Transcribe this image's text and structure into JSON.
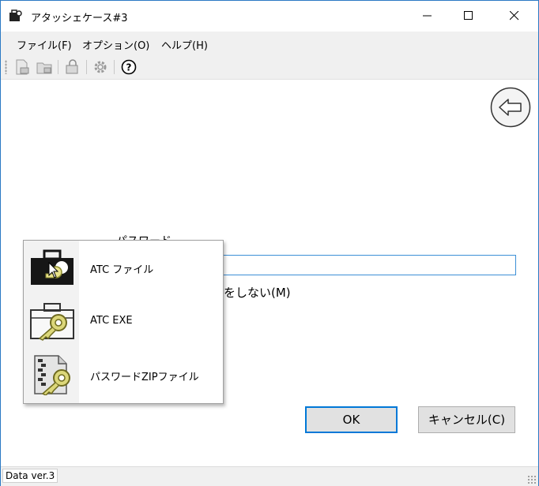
{
  "window": {
    "title": "アタッシェケース#3"
  },
  "menu": {
    "file": "ファイル(F)",
    "options": "オプション(O)",
    "help": "ヘルプ(H)"
  },
  "toolbar": {
    "icons": [
      "encrypt-file-icon",
      "decrypt-file-icon",
      "lock-icon",
      "settings-gear-icon",
      "help-icon"
    ]
  },
  "form": {
    "password_label": "パスワード",
    "password_value": "",
    "checkbox_label": "をしない(M)"
  },
  "popup": {
    "items": [
      {
        "label": "ATC ファイル"
      },
      {
        "label": "ATC EXE"
      },
      {
        "label": "パスワードZIPファイル"
      }
    ]
  },
  "buttons": {
    "ok": "OK",
    "cancel": "キャンセル(C)"
  },
  "status": {
    "text": "Data ver.3"
  }
}
